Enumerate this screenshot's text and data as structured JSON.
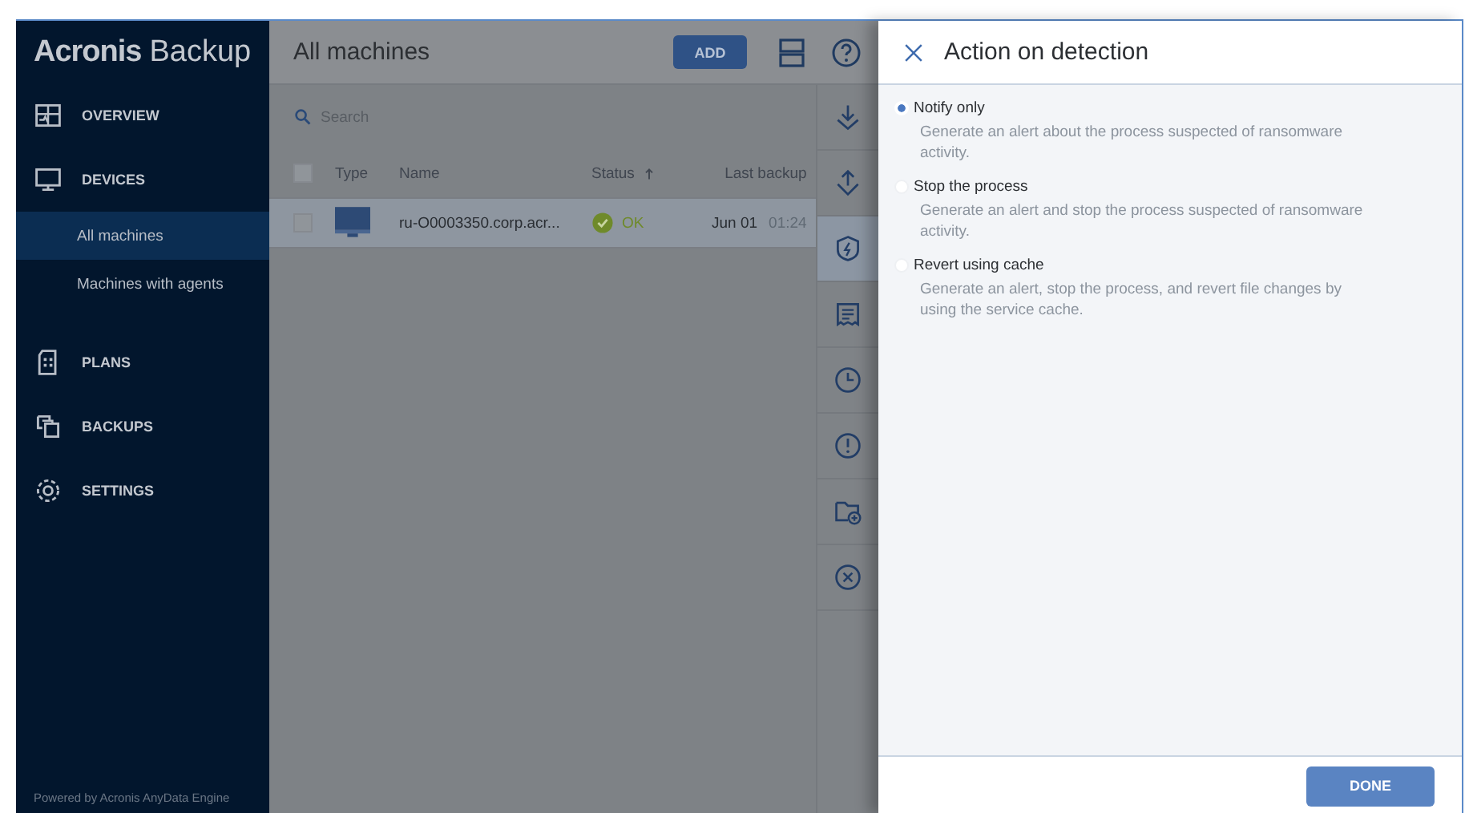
{
  "sidebar": {
    "logo": {
      "brand": "Acronis",
      "product": "Backup"
    },
    "items": [
      {
        "label": "OVERVIEW",
        "selected": false
      },
      {
        "label": "DEVICES",
        "selected": false,
        "children": [
          {
            "label": "All machines",
            "selected": true
          },
          {
            "label": "Machines with agents",
            "selected": false
          }
        ]
      },
      {
        "label": "PLANS",
        "selected": false
      },
      {
        "label": "BACKUPS",
        "selected": false
      },
      {
        "label": "SETTINGS",
        "selected": false
      }
    ],
    "footer": "Powered by Acronis AnyData Engine"
  },
  "main": {
    "title": "All machines",
    "add_button": "ADD",
    "search": {
      "placeholder": "Search"
    },
    "table": {
      "header_checked": false,
      "columns": [
        {
          "label": "Type",
          "sorted": false
        },
        {
          "label": "Name",
          "sorted": false
        },
        {
          "label": "Status",
          "sorted": true
        },
        {
          "label": "Last backup",
          "sorted": false
        }
      ],
      "rows": [
        {
          "selected": true,
          "checked": false,
          "name": "ru-O0003350.corp.acr...",
          "status": "OK",
          "last_backup_date": "Jun 01",
          "last_backup_time": "01:24"
        }
      ]
    }
  },
  "action_rail": [
    {
      "selected": false
    },
    {
      "selected": false
    },
    {
      "selected": true
    },
    {
      "selected": false
    },
    {
      "selected": false
    },
    {
      "selected": false
    },
    {
      "selected": false
    },
    {
      "selected": false
    }
  ],
  "panel": {
    "title": "Action on detection",
    "options": [
      {
        "label": "Notify only",
        "description": "Generate an alert about the process suspected of ransomware activity.",
        "selected": true
      },
      {
        "label": "Stop the process",
        "description": "Generate an alert and stop the process suspected of ransomware activity.",
        "selected": false
      },
      {
        "label": "Revert using cache",
        "description": "Generate an alert, stop the process, and revert file changes by using the service cache.",
        "selected": false
      }
    ],
    "done_button": "DONE"
  }
}
